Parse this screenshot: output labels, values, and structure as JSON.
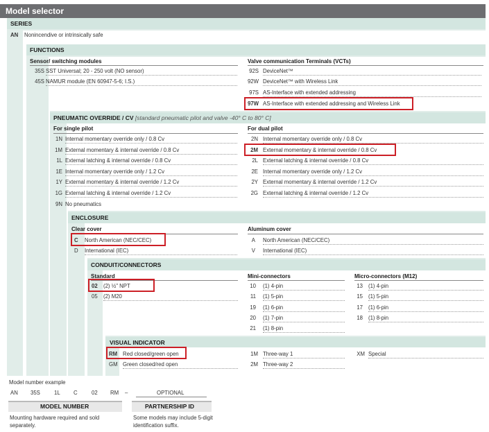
{
  "title": "Model selector",
  "series": {
    "header": "SERIES",
    "code": "AN",
    "desc": "Nonincendive or intrinsically safe"
  },
  "functions": {
    "header": "FUNCTIONS",
    "sensor_header": "Sensor/ switching modules",
    "sensor_items": [
      {
        "code": "35S",
        "desc": "SST Universal; 20 - 250 volt (NO sensor)"
      },
      {
        "code": "45S",
        "desc": "NAMUR module (EN 60947-5-6; I.S.)"
      }
    ],
    "vct_header": "Valve communication Terminals (VCTs)",
    "vct_items": [
      {
        "code": "92S",
        "desc": "DeviceNet™"
      },
      {
        "code": "92W",
        "desc": "DeviceNet™ with Wireless Link"
      },
      {
        "code": "97S",
        "desc": "AS-Interface with extended addressing"
      },
      {
        "code": "97W",
        "desc": "AS-Interface with extended addressing and Wireless Link"
      }
    ]
  },
  "pneumatic": {
    "header": "PNEUMATIC OVERRIDE / CV",
    "note": "[standard pneumatic pilot and valve -40° C to 80° C]",
    "single_header": "For single pilot",
    "single_items": [
      {
        "code": "1N",
        "desc": "Internal momentary override only / 0.8 Cv"
      },
      {
        "code": "1M",
        "desc": "External momentary & internal override / 0.8 Cv"
      },
      {
        "code": "1L",
        "desc": "External latching & internal override / 0.8 Cv"
      },
      {
        "code": "1E",
        "desc": "Internal momentary override only / 1.2 Cv"
      },
      {
        "code": "1Y",
        "desc": "External momentary & internal override / 1.2 Cv"
      },
      {
        "code": "1G",
        "desc": "External latching & internal override / 1.2 Cv"
      },
      {
        "code": "9N",
        "desc": "No pneumatics"
      }
    ],
    "dual_header": "For dual pilot",
    "dual_items": [
      {
        "code": "2N",
        "desc": "Internal momentary override only / 0.8 Cv"
      },
      {
        "code": "2M",
        "desc": "External momentary & internal override / 0.8 Cv"
      },
      {
        "code": "2L",
        "desc": "External latching & internal override / 0.8 Cv"
      },
      {
        "code": "2E",
        "desc": "Internal momentary override only / 1.2 Cv"
      },
      {
        "code": "2Y",
        "desc": "External momentary & internal override / 1.2 Cv"
      },
      {
        "code": "2G",
        "desc": "External latching & internal override / 1.2 Cv"
      }
    ]
  },
  "enclosure": {
    "header": "ENCLOSURE",
    "clear_header": "Clear cover",
    "clear_items": [
      {
        "code": "C",
        "desc": "North American (NEC/CEC)"
      },
      {
        "code": "D",
        "desc": "International (IEC)"
      }
    ],
    "alum_header": "Aluminum cover",
    "alum_items": [
      {
        "code": "A",
        "desc": "North American (NEC/CEC)"
      },
      {
        "code": "V",
        "desc": "International (IEC)"
      }
    ]
  },
  "conduit": {
    "header": "CONDUIT/CONNECTORS",
    "std_header": "Standard",
    "std_items": [
      {
        "code": "02",
        "desc": "(2) ½\" NPT"
      },
      {
        "code": "05",
        "desc": "(2) M20"
      }
    ],
    "mini_header": "Mini-connectors",
    "mini_items": [
      {
        "code": "10",
        "desc": "(1) 4-pin"
      },
      {
        "code": "11",
        "desc": "(1) 5-pin"
      },
      {
        "code": "19",
        "desc": "(1) 6-pin"
      },
      {
        "code": "20",
        "desc": "(1) 7-pin"
      },
      {
        "code": "21",
        "desc": "(1) 8-pin"
      }
    ],
    "micro_header": "Micro-connectors (M12)",
    "micro_items": [
      {
        "code": "13",
        "desc": "(1) 4-pin"
      },
      {
        "code": "15",
        "desc": "(1) 5-pin"
      },
      {
        "code": "17",
        "desc": "(1) 6-pin"
      },
      {
        "code": "18",
        "desc": "(1) 8-pin"
      }
    ]
  },
  "visual": {
    "header": "VISUAL INDICATOR",
    "items_a": [
      {
        "code": "RM",
        "desc": "Red closed/green open"
      },
      {
        "code": "GM",
        "desc": "Green closed/red open"
      }
    ],
    "items_b": [
      {
        "code": "1M",
        "desc": "Three-way 1"
      },
      {
        "code": "2M",
        "desc": "Three-way 2"
      }
    ],
    "items_c": [
      {
        "code": "XM",
        "desc": "Special"
      }
    ]
  },
  "example": {
    "label": "Model number example",
    "parts": [
      "AN",
      "35S",
      "1L",
      "C",
      "02",
      "RM",
      "–",
      "OPTIONAL"
    ],
    "model_number_label": "MODEL NUMBER",
    "model_number_note": "Mounting hardware required and sold separately.",
    "partnership_label": "PARTNERSHIP ID",
    "partnership_note": "Some models may include 5-digit identification suffix."
  }
}
